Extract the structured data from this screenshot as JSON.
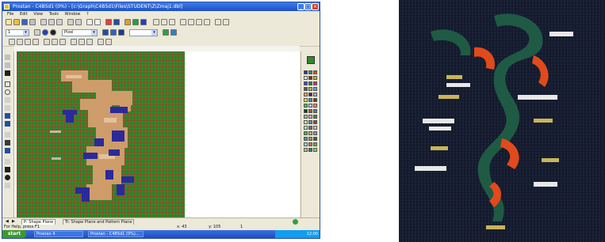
{
  "window": {
    "title": "Prostan - C4B5d1 (0%) - [c:\\Graph\\C4B5d1\\Files\\STUDENT\\Z\\Zmaj1.dbl]",
    "menu": [
      "File",
      "Edit",
      "View",
      "Tools",
      "Window",
      "?"
    ]
  },
  "toolbar": {
    "zoom_value": "1",
    "mode_value": "Pixel"
  },
  "bottom_tabs": [
    {
      "label": "P: Shape Plane"
    },
    {
      "label": "Tr: Shape Plane and Pattern Plane"
    }
  ],
  "status": {
    "left_text": "For Help, press F1",
    "coord_x": "x: 43",
    "coord_y": "y: 105",
    "page": "1"
  },
  "taskbar": {
    "start_label": "start",
    "tasks": [
      "Prostan 4",
      "Prostan - C4B5d1 (0%)..."
    ],
    "clock": "12:00"
  },
  "palette_colors": [
    "#1f3a8a",
    "#2a9a3a",
    "#e05020",
    "#f0f0f0",
    "#8a2a2a",
    "#d4b020",
    "#3050c0",
    "#208050",
    "#c03080",
    "#5a5a5a",
    "#a0c040",
    "#60a0e0",
    "#e0a060",
    "#402080",
    "#b0b0b0",
    "#e8e040",
    "#20a0a0",
    "#803010",
    "#40c060",
    "#c0c0f0",
    "#f08080",
    "#104020",
    "#a06030",
    "#6070a0"
  ],
  "colors": {
    "grid_green": "#2a8b2a",
    "grid_red": "#c82828",
    "dragon_tan": "#d9a070",
    "dragon_blue": "#2a2a9a",
    "photo_bg": "#141a2c"
  }
}
